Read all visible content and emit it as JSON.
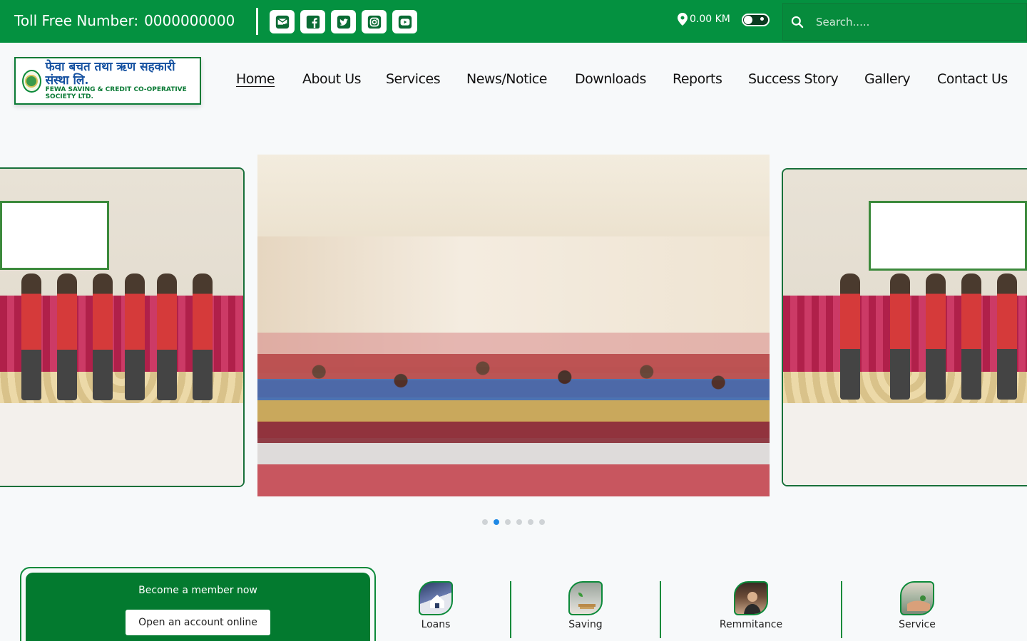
{
  "topbar": {
    "toll_label": "Toll Free Number:",
    "toll_number": "0000000000",
    "distance": "0.00 KM",
    "search_placeholder": "Search.....",
    "social": [
      {
        "name": "mail-icon"
      },
      {
        "name": "facebook-icon"
      },
      {
        "name": "twitter-icon"
      },
      {
        "name": "instagram-icon"
      },
      {
        "name": "youtube-icon"
      }
    ]
  },
  "logo": {
    "nepali_text": "फेवा बचत तथा ऋण सहकारी संस्था लि.",
    "english_text": "FEWA SAVING & CREDIT CO-OPERATIVE SOCIETY LTD."
  },
  "nav": {
    "items": [
      {
        "label": "Home",
        "active": true
      },
      {
        "label": "About Us"
      },
      {
        "label": "Services"
      },
      {
        "label": "News/Notice"
      },
      {
        "label": "Downloads"
      },
      {
        "label": "Reports"
      },
      {
        "label": "Success Story"
      },
      {
        "label": "Gallery"
      },
      {
        "label": "Contact Us"
      }
    ]
  },
  "slider": {
    "dots_count": 6,
    "active_index": 1
  },
  "member": {
    "title": "Become a member now",
    "button_label": "Open an account online"
  },
  "services": [
    {
      "label": "Loans"
    },
    {
      "label": "Saving"
    },
    {
      "label": "Remmitance"
    },
    {
      "label": "Service"
    }
  ],
  "colors": {
    "brand_green": "#049140",
    "dark_green": "#037a2f",
    "active_dot": "#1e88e5"
  }
}
